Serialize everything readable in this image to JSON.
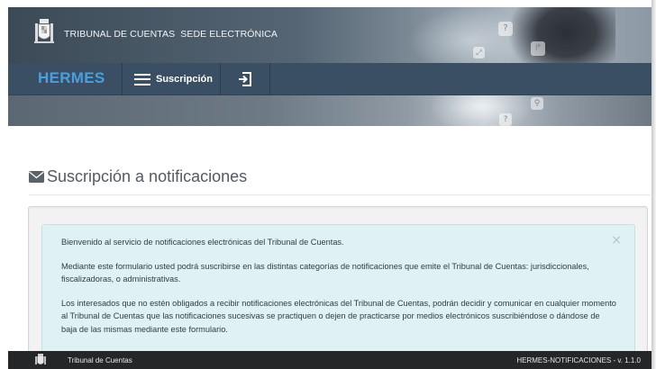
{
  "header": {
    "org_name": "TRIBUNAL DE CUENTAS",
    "sede": "SEDE ELECTRÓNICA",
    "decor_icons": [
      "question-icon",
      "share-icon",
      "expand-icon",
      "search-icon"
    ]
  },
  "nav": {
    "brand": "HERMES",
    "menu_label": "Suscripción",
    "logout_icon": "sign-in-icon",
    "colors": {
      "bar": "#3a4f63",
      "brand": "#4a9fdc"
    }
  },
  "page": {
    "heading_icon": "envelope-icon",
    "heading": "Suscripción a notificaciones"
  },
  "alert": {
    "close": "×",
    "paragraphs": [
      "Bienvenido al servicio de notificaciones electrónicas del Tribunal de Cuentas.",
      "Mediante este formulario usted podrá suscribirse en las distintas categorías de notificaciones que emite el Tribunal de Cuentas: jurisdiccionales, fiscalizadoras, o administrativas.",
      "Los interesados que no estén obligados a recibir notificaciones electrónicas del Tribunal de Cuentas, podrán decidir y comunicar en cualquier momento al Tribunal de Cuentas que las notificaciones sucesivas se practiquen o dejen de practicarse por medios electrónicos suscribiéndose o dándose de baja de las mismas mediante este formulario."
    ],
    "colors": {
      "background": "#dff1f3",
      "border": "#bfe2e6"
    }
  },
  "footer": {
    "org": "Tribunal de Cuentas",
    "version": "HERMES-NOTIFICACIONES - v. 1.1.0"
  }
}
